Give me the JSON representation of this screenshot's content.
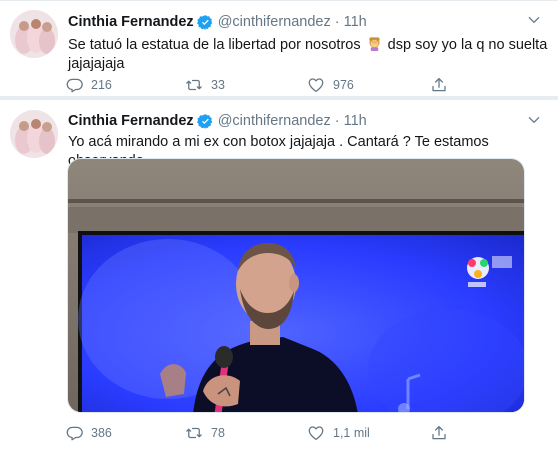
{
  "tweets": [
    {
      "author_name": "Cinthia Fernandez",
      "handle": "@cinthifernandez",
      "separator": "·",
      "time": "11h",
      "text_before_emoji": "Se tatuó la estatua de la libertad por nosotros ",
      "emoji_icon": "woman-facepalming-emoji-icon",
      "text_after_emoji": " dsp soy yo la q no suelta jajajajaja",
      "replies": "216",
      "retweets": "33",
      "likes": "976"
    },
    {
      "author_name": "Cinthia Fernandez",
      "handle": "@cinthifernandez",
      "separator": "·",
      "time": "11h",
      "text": "Yo acá mirando a mi ex con botox jajajaja . Cantará ? Te estamos observando",
      "replies": "386",
      "retweets": "78",
      "likes": "1,1 mil"
    }
  ],
  "icons": {
    "verified": "verified-badge-icon",
    "more": "chevron-down-icon",
    "reply": "reply-icon",
    "retweet": "retweet-icon",
    "like": "heart-icon",
    "share": "share-icon"
  },
  "colors": {
    "verified": "#1da1f2",
    "action_gray": "#657786",
    "separator": "#e6ecf0",
    "tv_screen_blue": "#2a3cff"
  }
}
